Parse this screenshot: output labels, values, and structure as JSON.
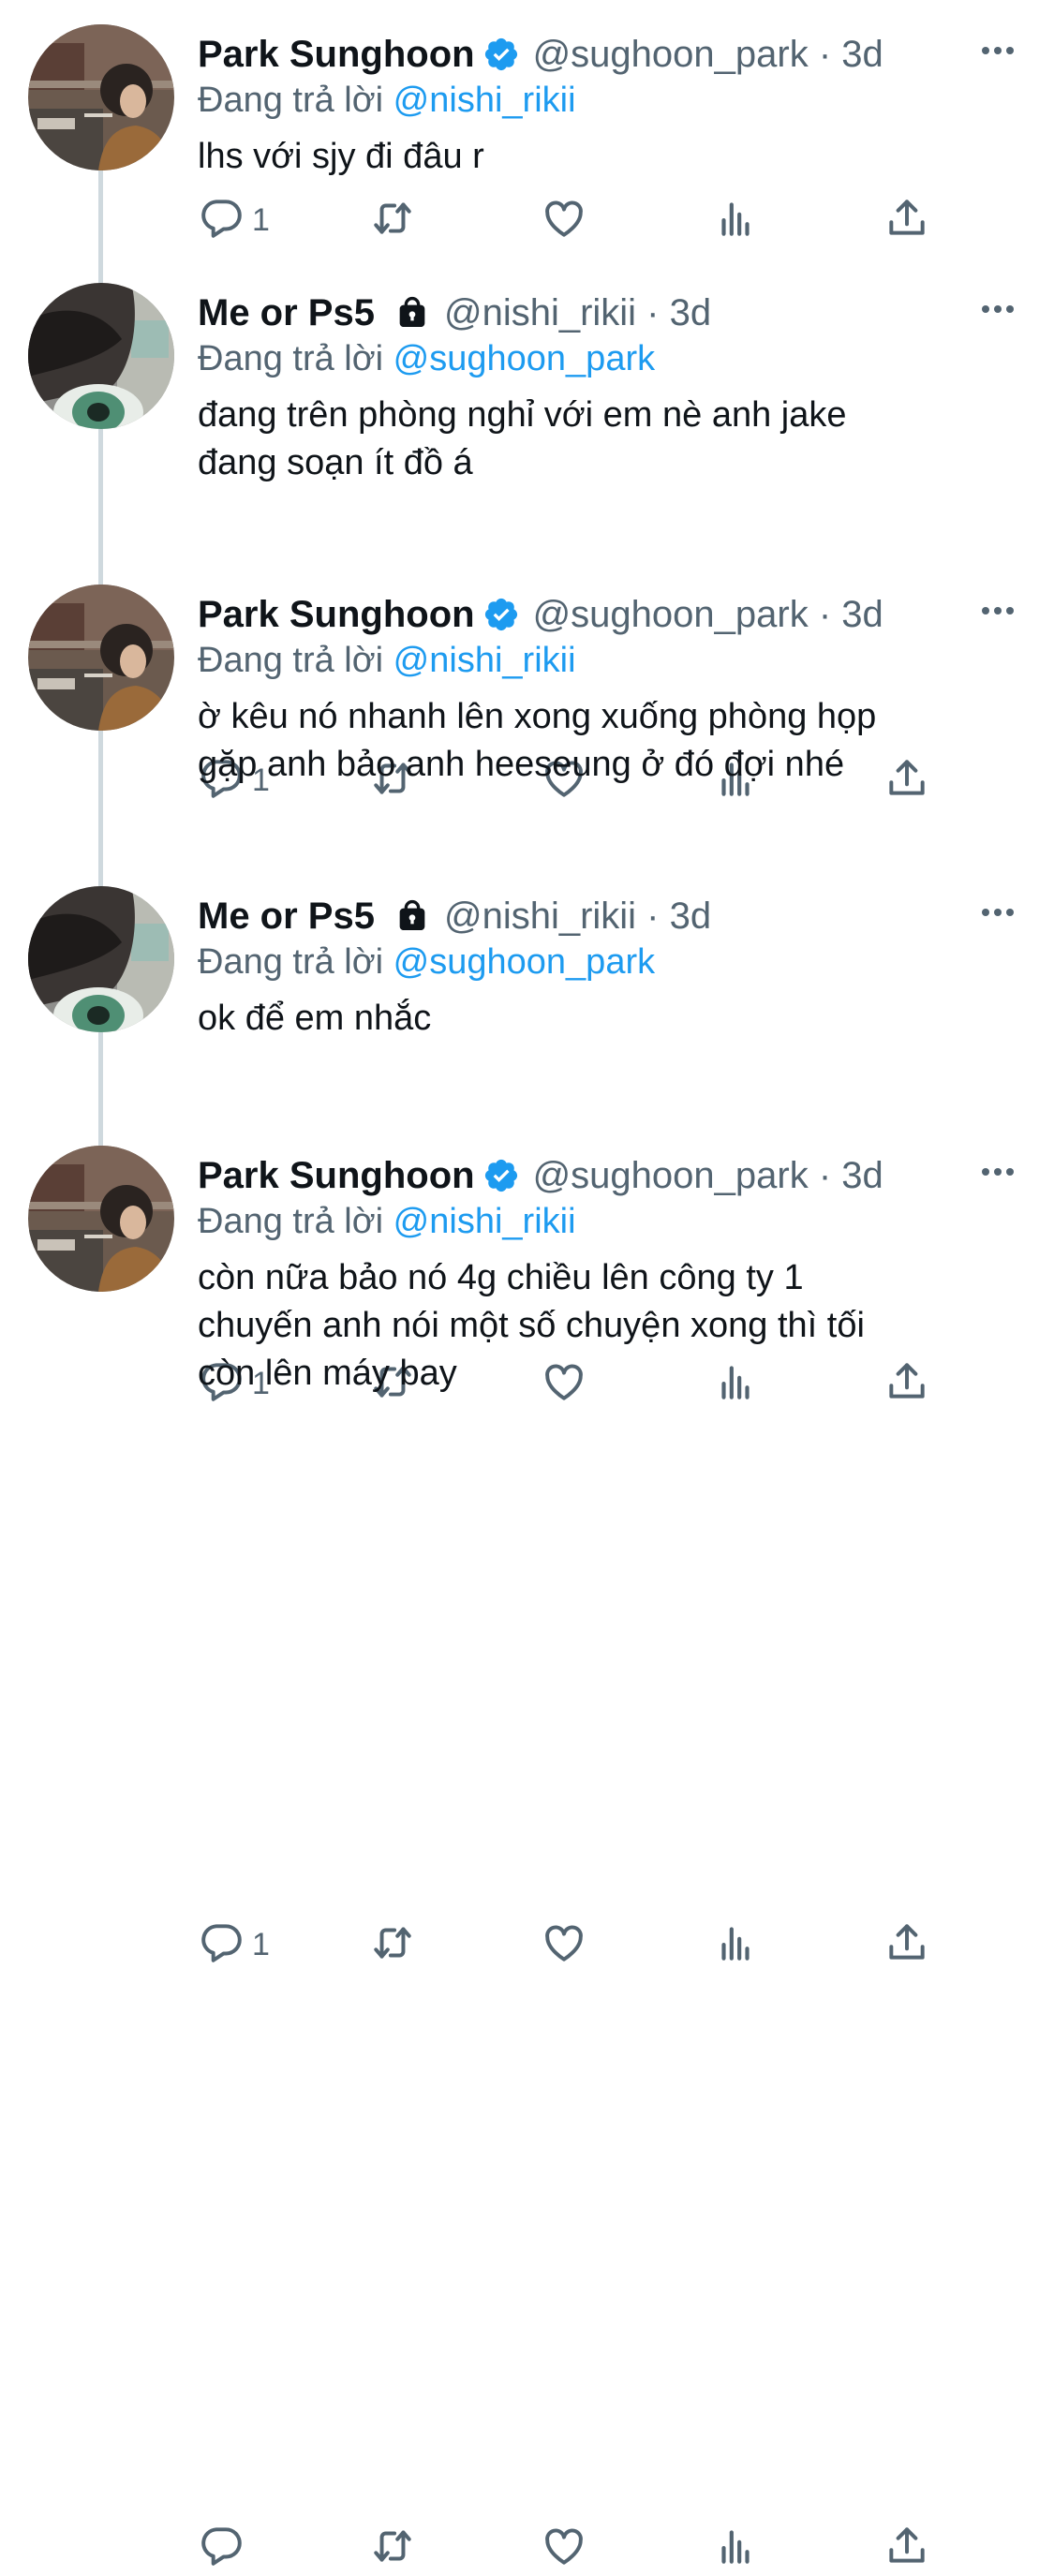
{
  "tweets": [
    {
      "name": "Park Sunghoon",
      "verified": true,
      "locked": false,
      "handle_time": "@sughoon_park · 3d",
      "replying_prefix": "Đang trả lời",
      "replying_to": "@nishi_rikii",
      "text": "lhs với sjy đi đâu r",
      "reply_count": "1"
    },
    {
      "name": "Me or Ps5",
      "verified": false,
      "locked": true,
      "handle_time": "@nishi_rikii · 3d",
      "replying_prefix": "Đang trả lời",
      "replying_to": "@sughoon_park",
      "text": "đang trên phòng nghỉ với em nè anh jake\nđang soạn ít đồ á",
      "reply_count": "1"
    },
    {
      "name": "Park Sunghoon",
      "verified": true,
      "locked": false,
      "handle_time": "@sughoon_park · 3d",
      "replying_prefix": "Đang trả lời",
      "replying_to": "@nishi_rikii",
      "text": "ờ kêu nó nhanh lên xong xuống phòng họp\ngặp anh bảo anh heeseung ở đó đợi nhé",
      "reply_count": "1"
    },
    {
      "name": "Me or Ps5",
      "verified": false,
      "locked": true,
      "handle_time": "@nishi_rikii · 3d",
      "replying_prefix": "Đang trả lời",
      "replying_to": "@sughoon_park",
      "text": "ok để em nhắc",
      "reply_count": "1"
    },
    {
      "name": "Park Sunghoon",
      "verified": true,
      "locked": false,
      "handle_time": "@sughoon_park · 3d",
      "replying_prefix": "Đang trả lời",
      "replying_to": "@nishi_rikii",
      "text": "còn nữa bảo nó 4g chiều lên công ty 1\nchuyến anh nói một số chuyện xong thì tối\ncòn lên máy bay",
      "reply_count": ""
    }
  ],
  "colors": {
    "text": "#0f1419",
    "secondary": "#536471",
    "link": "#1d9bf0",
    "thread_line": "#cfd9de"
  },
  "icons": [
    "verified-badge-icon",
    "lock-icon",
    "more-icon",
    "reply-icon",
    "retweet-icon",
    "like-icon",
    "views-icon",
    "share-icon"
  ]
}
